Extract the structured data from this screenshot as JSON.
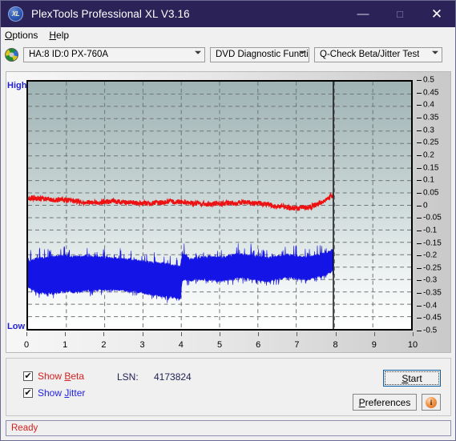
{
  "window": {
    "title": "PlexTools Professional XL V3.16",
    "icon": "xl-badge-icon",
    "minimize": "—",
    "maximize": "□",
    "close": "✕"
  },
  "menubar": {
    "items": [
      {
        "label": "Options",
        "accel": "O"
      },
      {
        "label": "Help",
        "accel": "H"
      }
    ]
  },
  "toolbar": {
    "drive_icon": "disc-icon",
    "drive": "HA:8 ID:0  PX-760A",
    "function": "DVD Diagnostic Functions",
    "test": "Q-Check Beta/Jitter Test"
  },
  "chart_labels": {
    "high": "High",
    "low": "Low"
  },
  "controls": {
    "show_beta": {
      "label_pre": "Show ",
      "accel": "B",
      "label_post": "eta",
      "checked": true,
      "mark": "✔"
    },
    "show_jitter": {
      "label_pre": "Show ",
      "accel": "J",
      "label_post": "itter",
      "checked": true,
      "mark": "✔"
    },
    "lsn_label": "LSN:",
    "lsn_value": "4173824",
    "start": {
      "pre": "",
      "accel": "S",
      "post": "tart"
    },
    "preferences": {
      "pre": "",
      "accel": "P",
      "post": "references"
    },
    "info_glyph": "i"
  },
  "statusbar": {
    "text": "Ready"
  },
  "colors": {
    "titlebar": "#2b2358",
    "beta": "#ee1111",
    "jitter": "#1414e6",
    "axis_label": "#2222cc",
    "status_text": "#d42020",
    "plot_top": "#9fb3b5",
    "plot_bottom": "#ffffff"
  },
  "chart_data": {
    "type": "line",
    "title": "Q-Check Beta/Jitter Test",
    "xlabel": "",
    "ylabel": "",
    "xlim": [
      0,
      10
    ],
    "ylim": [
      -0.5,
      0.5
    ],
    "xticks": [
      0,
      1,
      2,
      3,
      4,
      5,
      6,
      7,
      8,
      9,
      10
    ],
    "yticks": [
      0.5,
      0.45,
      0.4,
      0.35,
      0.3,
      0.25,
      0.2,
      0.15,
      0.1,
      0.05,
      0,
      -0.05,
      -0.1,
      -0.15,
      -0.2,
      -0.25,
      -0.3,
      -0.35,
      -0.4,
      -0.45,
      -0.5
    ],
    "grid": true,
    "legend": [
      "Show Beta",
      "Show Jitter"
    ],
    "data_end_marker_x": 7.97,
    "annotations": [
      "Data recorded from x=0 to x=7.97; vertical black marker line at end of recorded data"
    ],
    "series": [
      {
        "name": "Beta",
        "color": "#ee1111",
        "kind": "noisy-line",
        "x": [
          0.0,
          0.25,
          0.5,
          0.75,
          1.0,
          1.25,
          1.5,
          1.75,
          2.0,
          2.25,
          2.5,
          2.75,
          3.0,
          3.25,
          3.5,
          3.75,
          4.0,
          4.25,
          4.5,
          4.75,
          5.0,
          5.25,
          5.5,
          5.75,
          6.0,
          6.25,
          6.5,
          6.75,
          7.0,
          7.25,
          7.4,
          7.55,
          7.7,
          7.85,
          7.95
        ],
        "mean": [
          0.03,
          0.028,
          0.024,
          0.02,
          0.022,
          0.018,
          0.012,
          0.01,
          0.014,
          0.016,
          0.013,
          0.01,
          0.008,
          0.009,
          0.012,
          0.014,
          0.015,
          0.01,
          0.006,
          0.004,
          0.006,
          0.008,
          0.01,
          0.012,
          0.009,
          0.004,
          -0.002,
          -0.008,
          -0.012,
          -0.01,
          -0.006,
          0.004,
          0.016,
          0.03,
          0.042
        ],
        "noise_amp": 0.01
      },
      {
        "name": "Jitter",
        "color": "#1414e6",
        "kind": "band",
        "x": [
          0.0,
          0.25,
          0.5,
          0.75,
          1.0,
          1.25,
          1.5,
          1.75,
          2.0,
          2.25,
          2.5,
          2.75,
          3.0,
          3.25,
          3.5,
          3.75,
          3.97,
          4.03,
          4.25,
          4.5,
          4.75,
          5.0,
          5.25,
          5.5,
          5.75,
          6.0,
          6.25,
          6.5,
          6.75,
          7.0,
          7.25,
          7.5,
          7.7,
          7.85,
          7.95
        ],
        "upper": [
          -0.23,
          -0.215,
          -0.212,
          -0.208,
          -0.205,
          -0.21,
          -0.205,
          -0.208,
          -0.212,
          -0.215,
          -0.218,
          -0.222,
          -0.228,
          -0.232,
          -0.236,
          -0.242,
          -0.248,
          -0.196,
          -0.218,
          -0.212,
          -0.208,
          -0.214,
          -0.206,
          -0.198,
          -0.204,
          -0.21,
          -0.214,
          -0.208,
          -0.2,
          -0.206,
          -0.212,
          -0.204,
          -0.196,
          -0.188,
          -0.178
        ],
        "lower": [
          -0.33,
          -0.352,
          -0.356,
          -0.352,
          -0.348,
          -0.35,
          -0.344,
          -0.342,
          -0.34,
          -0.338,
          -0.344,
          -0.348,
          -0.354,
          -0.36,
          -0.366,
          -0.372,
          -0.38,
          -0.3,
          -0.302,
          -0.298,
          -0.3,
          -0.306,
          -0.3,
          -0.292,
          -0.296,
          -0.302,
          -0.306,
          -0.298,
          -0.29,
          -0.294,
          -0.3,
          -0.292,
          -0.284,
          -0.274,
          -0.262
        ],
        "spike_amp": 0.045
      }
    ]
  }
}
